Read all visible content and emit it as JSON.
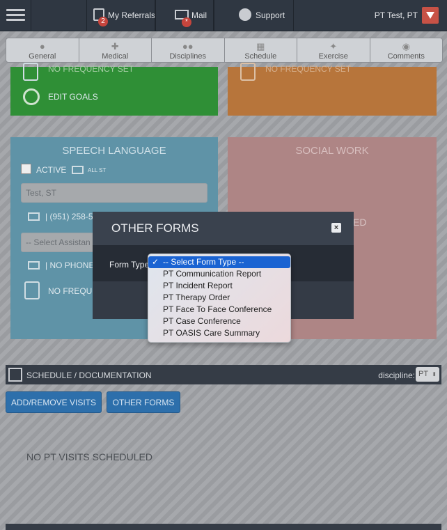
{
  "nav": {
    "referrals_label": "My Referrals",
    "referrals_badge": "2",
    "mail_label": "Mail",
    "mail_badge": "*",
    "support_label": "Support",
    "user_name": "PT Test, PT"
  },
  "tabs": [
    "General",
    "Medical",
    "Disciplines",
    "Schedule",
    "Exercise",
    "Comments"
  ],
  "cards": {
    "top_left_partial": "NO FREQUENCY SET",
    "edit_goals": "EDIT GOALS",
    "top_right_partial": "NO FREQUENCY SET",
    "speech": {
      "title": "SPEECH LANGUAGE",
      "active_label": "ACTIVE",
      "all_label": "ALL ST",
      "therapist": "Test, ST",
      "phone": "| (951) 258-5",
      "assistant_placeholder": "-- Select Assistan",
      "no_phone": "| NO PHONE",
      "no_frequency": "NO FREQUE"
    },
    "social": {
      "title": "SOCIAL WORK",
      "partial_text": "ED"
    }
  },
  "schedule": {
    "title": "SCHEDULE / DOCUMENTATION",
    "discipline_label": "discipline:",
    "discipline_value": "PT",
    "add_remove_button": "ADD/REMOVE VISITS",
    "other_forms_button": "OTHER FORMS",
    "empty_text": "NO PT VISITS SCHEDULED"
  },
  "modal": {
    "title": "OTHER FORMS",
    "close_label": "×",
    "form_type_label": "Form Type",
    "options": [
      "-- Select Form Type --",
      "PT Communication Report",
      "PT Incident Report",
      "PT Therapy Order",
      "PT Face To Face Conference",
      "PT Case Conference",
      "PT OASIS Care Summary"
    ],
    "selected_index": 0
  },
  "colors": {
    "nav_bg": "#2f3742",
    "green_card": "#2f8f36",
    "orange_card": "#b7753b",
    "blue_card": "#5f93a7",
    "pink_card": "#ae8585",
    "button_blue": "#2d6fab",
    "selected_option": "#1a63d2"
  }
}
